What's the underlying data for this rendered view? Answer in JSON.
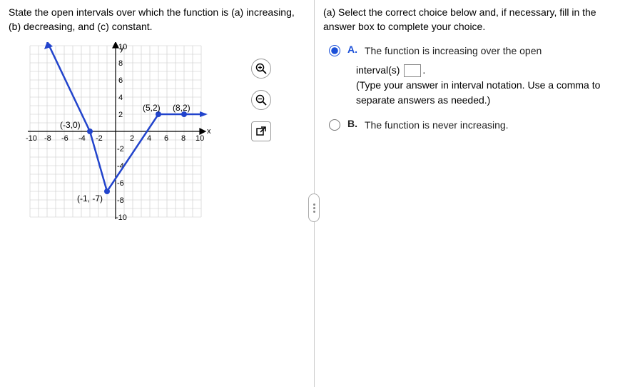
{
  "question": {
    "prompt": "State the open intervals over which the function is (a) increasing, (b) decreasing, and (c) constant."
  },
  "chart_data": {
    "type": "line",
    "x": [
      -8,
      -3,
      -1,
      5,
      8,
      10.5
    ],
    "y": [
      10.5,
      0,
      -7,
      2,
      2,
      2
    ],
    "points_labeled": [
      {
        "x": -3,
        "y": 0,
        "label": "(-3,0)"
      },
      {
        "x": -1,
        "y": -7,
        "label": "(-1,-7)"
      },
      {
        "x": 5,
        "y": 2,
        "label": "(5,2)"
      },
      {
        "x": 8,
        "y": 2,
        "label": "(8,2)"
      }
    ],
    "arrows_at": [
      "start",
      "end"
    ],
    "xlabel": "x",
    "ylabel": "y",
    "xlim": [
      -10,
      10
    ],
    "ylim": [
      -10,
      10
    ],
    "xticks": [
      -10,
      -8,
      -6,
      -4,
      -2,
      2,
      4,
      6,
      8,
      10
    ],
    "yticks": [
      -10,
      -8,
      -6,
      -4,
      -2,
      2,
      4,
      6,
      8,
      10
    ],
    "grid": true
  },
  "right": {
    "instruction": "(a) Select the correct choice below and, if necessary, fill in the answer box to complete your choice.",
    "A": {
      "letter": "A.",
      "line1a": "The function is increasing over the open",
      "line1b": "interval(s)",
      "period": ".",
      "hint": "(Type your answer in interval notation. Use a comma to separate answers as needed.)"
    },
    "B": {
      "letter": "B.",
      "text": "The function is never increasing."
    }
  },
  "axis": {
    "x": "x",
    "y": "y",
    "t10": "10",
    "t8": "8",
    "t6": "6",
    "t4": "4",
    "t2": "2",
    "tn2": "-2",
    "tn4": "-4",
    "tn6": "-6",
    "tn8": "-8",
    "tn10": "-10",
    "p1": "(-3,0)",
    "p2": "(-1, -7)",
    "p3": "(5,2)",
    "p4": "(8,2)"
  }
}
